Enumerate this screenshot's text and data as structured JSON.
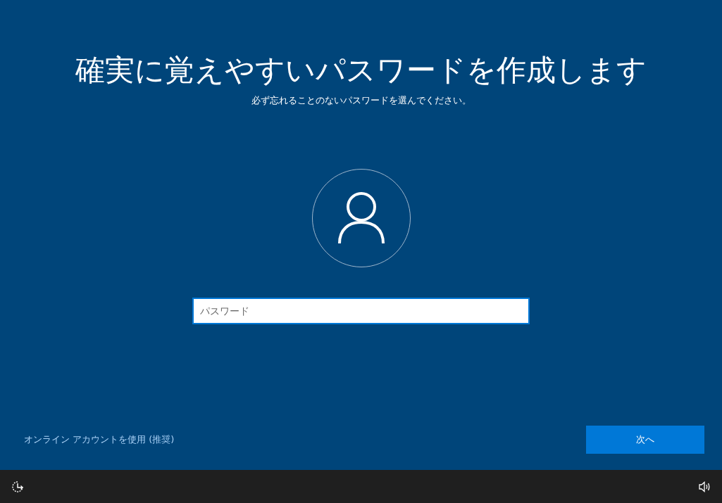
{
  "title": "確実に覚えやすいパスワードを作成します",
  "subtitle": "必ず忘れることのないパスワードを選んでください。",
  "password_field": {
    "placeholder": "パスワード"
  },
  "link": "オンライン アカウントを使用 (推奨)",
  "next_button": "次へ"
}
